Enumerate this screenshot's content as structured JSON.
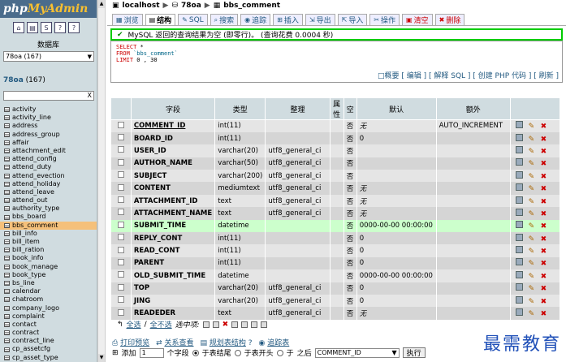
{
  "logo": {
    "php": "php",
    "my": "MyAdmin"
  },
  "sidebar": {
    "db_label": "数据库",
    "db_select_value": "78oa (167)",
    "db_title_name": "78oa",
    "db_title_count": "(167)",
    "filter_clear": "X",
    "tables": [
      "activity",
      "activity_line",
      "address",
      "address_group",
      "affair",
      "attachment_edit",
      "attend_config",
      "attend_duty",
      "attend_evection",
      "attend_holiday",
      "attend_leave",
      "attend_out",
      "authority_type",
      "bbs_board",
      "bbs_comment",
      "bill_info",
      "bill_item",
      "bill_ration",
      "book_info",
      "book_manage",
      "book_type",
      "bs_line",
      "calendar",
      "chatroom",
      "company_logo",
      "complaint",
      "contact",
      "contract",
      "contract_line",
      "cp_assetcfg",
      "cp_asset_type"
    ],
    "active_table": "bbs_comment"
  },
  "crumb": {
    "server": "localhost",
    "database": "78oa",
    "table": "bbs_comment"
  },
  "tabs": [
    {
      "label": "浏览",
      "icon": "▦",
      "active": false
    },
    {
      "label": "结构",
      "icon": "▤",
      "active": true
    },
    {
      "label": "SQL",
      "icon": "✎",
      "active": false
    },
    {
      "label": "搜索",
      "icon": "⌕",
      "active": false
    },
    {
      "label": "追踪",
      "icon": "◉",
      "active": false
    },
    {
      "label": "插入",
      "icon": "⊞",
      "active": false
    },
    {
      "label": "导出",
      "icon": "⇲",
      "active": false
    },
    {
      "label": "导入",
      "icon": "⇱",
      "active": false
    },
    {
      "label": "操作",
      "icon": "✂",
      "active": false
    },
    {
      "label": "清空",
      "icon": "▣",
      "active": false,
      "danger": true
    },
    {
      "label": "删除",
      "icon": "✖",
      "active": false,
      "danger": true
    }
  ],
  "message": "MySQL 返回的查询结果为空 (即零行)。 (查询花费 0.0004 秒)",
  "sql": {
    "l1_kw": "SELECT",
    "l1_rest": " *",
    "l2_kw": "FROM",
    "l2_str": " `bbs_comment`",
    "l3_kw": "LIMIT",
    "l3_rest": " 0 , 30"
  },
  "sql_links": "□概要 [ 编辑 ] [ 解释 SQL ] [ 创建 PHP 代码 ] [ 刷新 ]",
  "columns": [
    "字段",
    "类型",
    "整理",
    "属性",
    "空",
    "默认",
    "额外"
  ],
  "rows": [
    {
      "name": "COMMENT_ID",
      "type": "int(11)",
      "coll": "",
      "attr": "",
      "null": "否",
      "def": "无",
      "extra": "AUTO_INCREMENT",
      "pk": true
    },
    {
      "name": "BOARD_ID",
      "type": "int(11)",
      "coll": "",
      "attr": "",
      "null": "否",
      "def": "0",
      "extra": ""
    },
    {
      "name": "USER_ID",
      "type": "varchar(20)",
      "coll": "utf8_general_ci",
      "attr": "",
      "null": "否",
      "def": "",
      "extra": ""
    },
    {
      "name": "AUTHOR_NAME",
      "type": "varchar(50)",
      "coll": "utf8_general_ci",
      "attr": "",
      "null": "否",
      "def": "",
      "extra": ""
    },
    {
      "name": "SUBJECT",
      "type": "varchar(200)",
      "coll": "utf8_general_ci",
      "attr": "",
      "null": "否",
      "def": "",
      "extra": ""
    },
    {
      "name": "CONTENT",
      "type": "mediumtext",
      "coll": "utf8_general_ci",
      "attr": "",
      "null": "否",
      "def": "无",
      "extra": ""
    },
    {
      "name": "ATTACHMENT_ID",
      "type": "text",
      "coll": "utf8_general_ci",
      "attr": "",
      "null": "否",
      "def": "无",
      "extra": ""
    },
    {
      "name": "ATTACHMENT_NAME",
      "type": "text",
      "coll": "utf8_general_ci",
      "attr": "",
      "null": "否",
      "def": "无",
      "extra": ""
    },
    {
      "name": "SUBMIT_TIME",
      "type": "datetime",
      "coll": "",
      "attr": "",
      "null": "否",
      "def": "0000-00-00 00:00:00",
      "extra": "",
      "hl": true
    },
    {
      "name": "REPLY_CONT",
      "type": "int(11)",
      "coll": "",
      "attr": "",
      "null": "否",
      "def": "0",
      "extra": ""
    },
    {
      "name": "READ_CONT",
      "type": "int(11)",
      "coll": "",
      "attr": "",
      "null": "否",
      "def": "0",
      "extra": ""
    },
    {
      "name": "PARENT",
      "type": "int(11)",
      "coll": "",
      "attr": "",
      "null": "否",
      "def": "0",
      "extra": ""
    },
    {
      "name": "OLD_SUBMIT_TIME",
      "type": "datetime",
      "coll": "",
      "attr": "",
      "null": "否",
      "def": "0000-00-00 00:00:00",
      "extra": ""
    },
    {
      "name": "TOP",
      "type": "varchar(20)",
      "coll": "utf8_general_ci",
      "attr": "",
      "null": "否",
      "def": "0",
      "extra": ""
    },
    {
      "name": "JING",
      "type": "varchar(20)",
      "coll": "utf8_general_ci",
      "attr": "",
      "null": "否",
      "def": "0",
      "extra": ""
    },
    {
      "name": "READEDER",
      "type": "text",
      "coll": "utf8_general_ci",
      "attr": "",
      "null": "否",
      "def": "无",
      "extra": ""
    }
  ],
  "bulk": {
    "check_all": "全选",
    "uncheck_all": "全不选",
    "selected": "选中项:"
  },
  "footer": {
    "print": "打印预览",
    "relation": "关系查看",
    "propose": "规划表结构",
    "track": "追踪表",
    "add_label": "添加",
    "add_count": "1",
    "field_label": "个字段",
    "end": "于表结尾",
    "begin": "于表开头",
    "after": "于",
    "after_suffix": "之后",
    "after_field": "COMMENT_ID",
    "go": "执行"
  },
  "watermark": "最需教育"
}
